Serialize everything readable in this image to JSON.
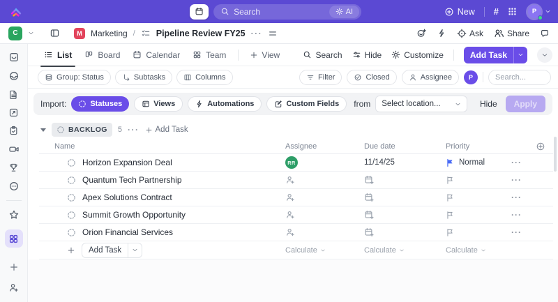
{
  "topbar": {
    "search_placeholder": "Search",
    "ai_label": "AI",
    "new_label": "New",
    "hash_label": "#",
    "avatar_initial": "P"
  },
  "titlebar": {
    "workspace_initial": "C",
    "breadcrumb": {
      "space": "Marketing",
      "separator": "/",
      "page": "Pipeline Review FY25"
    },
    "ask_label": "Ask",
    "share_label": "Share"
  },
  "tabs": {
    "items": [
      {
        "label": "List"
      },
      {
        "label": "Board"
      },
      {
        "label": "Calendar"
      },
      {
        "label": "Team"
      }
    ],
    "add_view_label": "View",
    "search_label": "Search",
    "hide_label": "Hide",
    "customize_label": "Customize",
    "add_task_label": "Add Task"
  },
  "filters": {
    "group_by": "Group: Status",
    "subtasks": "Subtasks",
    "columns": "Columns",
    "filter": "Filter",
    "closed": "Closed",
    "assignee": "Assignee",
    "assignee_avatar": "P",
    "search_placeholder": "Search..."
  },
  "import_banner": {
    "label": "Import:",
    "selected": "Statuses",
    "views": "Views",
    "automations": "Automations",
    "custom_fields": "Custom Fields",
    "from_label": "from",
    "location_placeholder": "Select location...",
    "hide_label": "Hide",
    "apply_label": "Apply"
  },
  "group": {
    "name": "BACKLOG",
    "count": "5",
    "add_task_label": "Add Task"
  },
  "table": {
    "columns": [
      "Name",
      "Assignee",
      "Due date",
      "Priority"
    ],
    "rows": [
      {
        "name": "Horizon Expansion Deal",
        "assignee": "RR",
        "due": "11/14/25",
        "priority": "Normal"
      },
      {
        "name": "Quantum Tech Partnership",
        "assignee": "",
        "due": "",
        "priority": ""
      },
      {
        "name": "Apex Solutions Contract",
        "assignee": "",
        "due": "",
        "priority": ""
      },
      {
        "name": "Summit Growth Opportunity",
        "assignee": "",
        "due": "",
        "priority": ""
      },
      {
        "name": "Orion Financial Services",
        "assignee": "",
        "due": "",
        "priority": ""
      }
    ],
    "footer": {
      "add_task_label": "Add Task",
      "calculate_label": "Calculate"
    }
  },
  "colors": {
    "topbar_purple": "#5b49d3",
    "accent_purple": "#6a4de8",
    "space_red": "#e2445c",
    "workspace_green": "#2aa55f",
    "assignee_green": "#2e9e68",
    "priority_normal_blue": "#4a6bf5",
    "online_dot_green": "#3ddc84"
  },
  "icon_names": [
    "clickup-logo",
    "calendar",
    "search",
    "ai-gear",
    "plus-circle",
    "hash",
    "grid-apps",
    "chevron-down",
    "sidebar-toggle",
    "checklist",
    "emoji-add",
    "bolt",
    "ask-target",
    "share-people",
    "chat-bubble",
    "list",
    "board",
    "team",
    "sliders-hide",
    "gear-customize",
    "layers-group",
    "subtasks",
    "columns",
    "filter",
    "check-circle-closed",
    "person",
    "status-dashed-circle",
    "views-grid",
    "custom-fields-edit",
    "home",
    "inbox",
    "docs",
    "whiteboards",
    "clipboard-check",
    "video-clips",
    "trophy-goals",
    "more-dots",
    "star-favorites",
    "apps-grid",
    "plus",
    "invite-person",
    "person-add",
    "calendar-add",
    "flag"
  ]
}
